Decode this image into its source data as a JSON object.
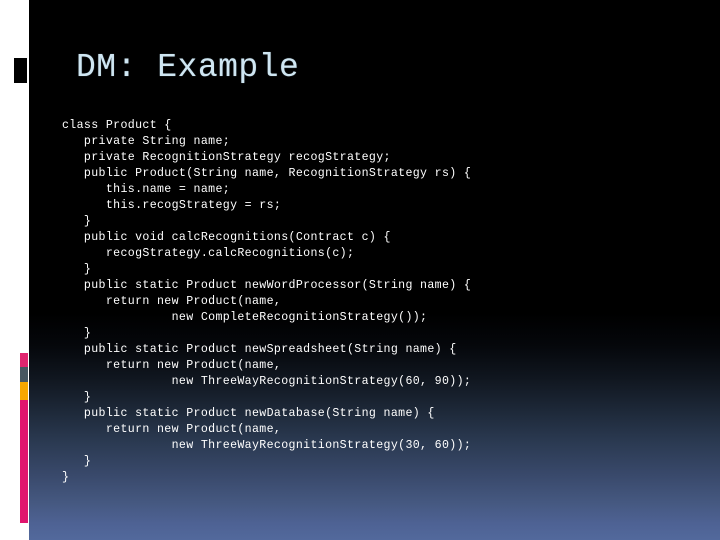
{
  "slide": {
    "title": "DM: Example",
    "title_color": "#cfe6f2",
    "background_top_color": "#000000",
    "background_bottom_color": "#52699c",
    "code_text_color": "#ffffff"
  },
  "accent_bar": {
    "segments": [
      {
        "name": "pink-top",
        "color": "#e0256f"
      },
      {
        "name": "slate",
        "color": "#475761"
      },
      {
        "name": "amber",
        "color": "#f7a700"
      },
      {
        "name": "magenta",
        "color": "#e0156e"
      }
    ]
  },
  "code": {
    "language": "java",
    "lines": [
      "class Product {",
      "   private String name;",
      "   private RecognitionStrategy recogStrategy;",
      "   public Product(String name, RecognitionStrategy rs) {",
      "      this.name = name;",
      "      this.recogStrategy = rs;",
      "   }",
      "   public void calcRecognitions(Contract c) {",
      "      recogStrategy.calcRecognitions(c);",
      "   }",
      "   public static Product newWordProcessor(String name) {",
      "      return new Product(name,",
      "               new CompleteRecognitionStrategy());",
      "   }",
      "   public static Product newSpreadsheet(String name) {",
      "      return new Product(name,",
      "               new ThreeWayRecognitionStrategy(60, 90));",
      "   }",
      "   public static Product newDatabase(String name) {",
      "      return new Product(name,",
      "               new ThreeWayRecognitionStrategy(30, 60));",
      "   }",
      "}"
    ]
  }
}
